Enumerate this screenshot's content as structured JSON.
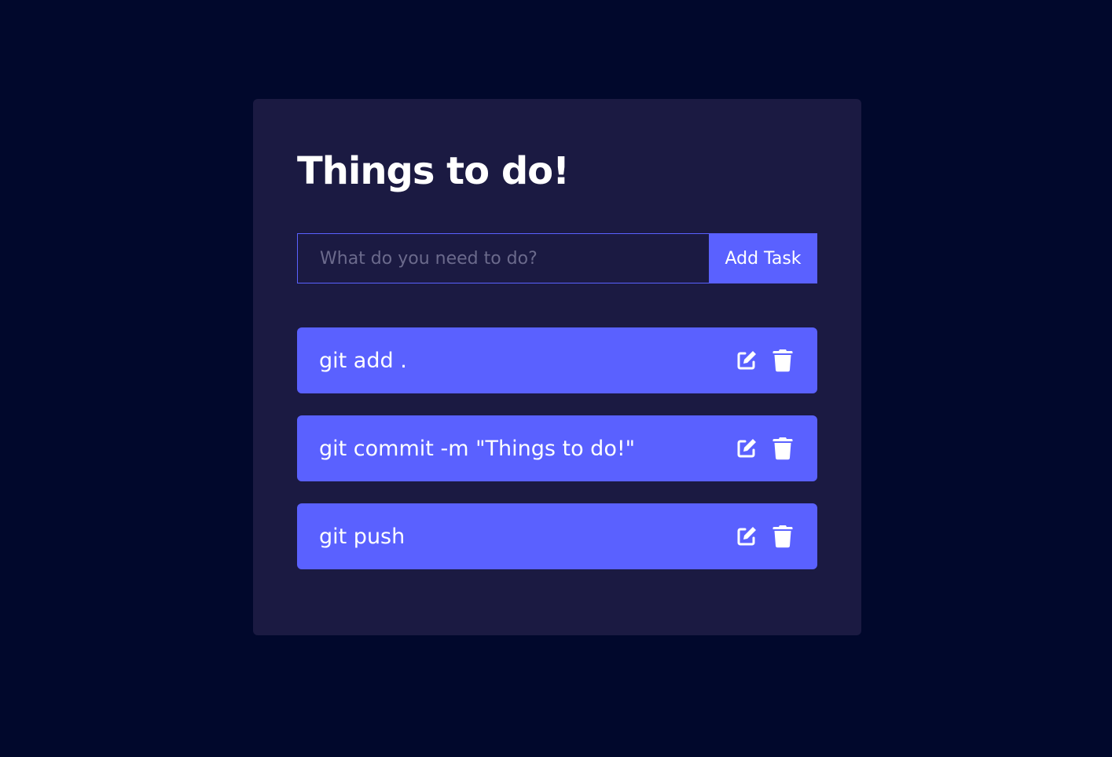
{
  "header": {
    "title": "Things to do!"
  },
  "form": {
    "placeholder": "What do you need to do?",
    "value": "",
    "add_label": "Add Task"
  },
  "todos": [
    {
      "text": "git add .",
      "edit_icon": "edit-icon",
      "delete_icon": "trash-icon"
    },
    {
      "text": "git commit -m \"Things to do!\"",
      "edit_icon": "edit-icon",
      "delete_icon": "trash-icon"
    },
    {
      "text": "git push",
      "edit_icon": "edit-icon",
      "delete_icon": "trash-icon"
    }
  ],
  "colors": {
    "background": "#01082c",
    "card": "#1b1a42",
    "accent": "#5a61ff",
    "text": "#ffffff",
    "placeholder": "#6b6a8c"
  }
}
